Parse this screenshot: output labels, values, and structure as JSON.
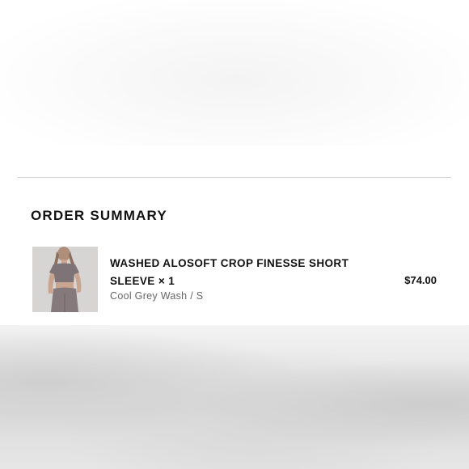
{
  "order_summary": {
    "heading": "ORDER SUMMARY",
    "items": [
      {
        "name_line_1": "WASHED ALOSOFT CROP FINESSE SHORT",
        "name_line_2": "SLEEVE × 1",
        "variant": "Cool Grey Wash / S",
        "price": "$74.00",
        "image": "product-photo-cropped-tee",
        "garment_color": "#7e7478"
      }
    ]
  },
  "colors": {
    "text_primary": "#111111",
    "text_secondary": "#666666",
    "divider": "#d6d6d6"
  }
}
